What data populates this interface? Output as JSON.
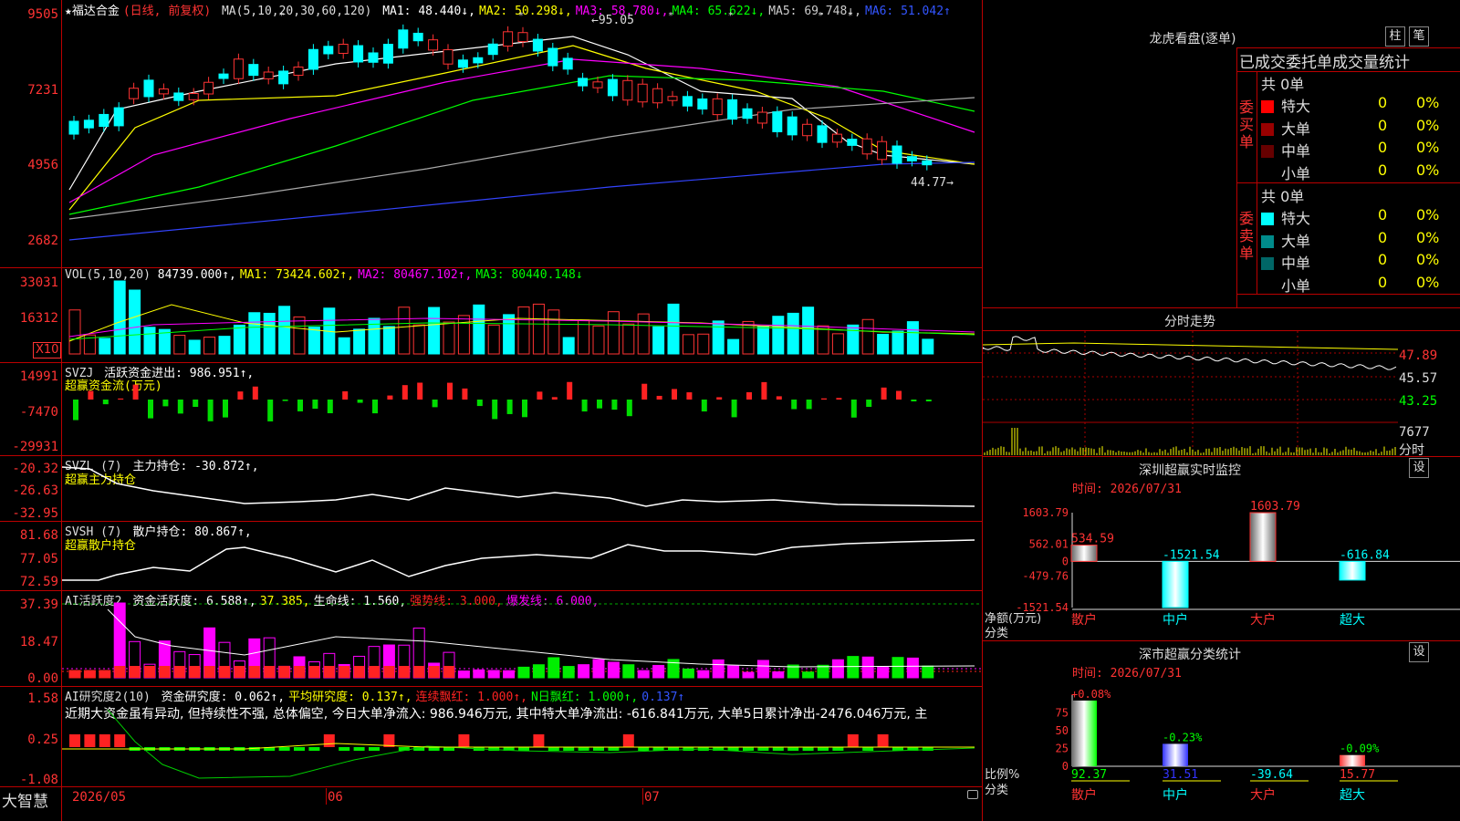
{
  "main_chart": {
    "title_star": "★",
    "stock_name": "福达合金",
    "period": "(日线, 前复权)",
    "ma_label": "MA(5,10,20,30,60,120)",
    "ma": [
      {
        "text": "MA1: 48.440↓,",
        "color": "#ffffff"
      },
      {
        "text": "MA2: 50.298↓,",
        "color": "#ffff00"
      },
      {
        "text": "MA3: 58.780↓,",
        "color": "#ff00ff"
      },
      {
        "text": "MA4: 65.622↓,",
        "color": "#00ff00"
      },
      {
        "text": "MA5: 69.748↓,",
        "color": "#cccccc"
      },
      {
        "text": "MA6: 51.042↑",
        "color": "#3355ff"
      }
    ],
    "y_labels": [
      "9505",
      "7231",
      "4956",
      "2682"
    ],
    "high_label": "95.05",
    "low_label": "44.77"
  },
  "vol_panel": {
    "label": "VOL(5,10,20)",
    "value": "84739.000↑,",
    "ma": [
      {
        "text": "MA1: 73424.602↑,",
        "color": "#ffff00"
      },
      {
        "text": "MA2: 80467.102↑,",
        "color": "#ff00ff"
      },
      {
        "text": "MA3: 80440.148↓",
        "color": "#00ff00"
      }
    ],
    "y_labels": [
      "33031",
      "16312"
    ],
    "unit": "X10"
  },
  "svzj_panel": {
    "label": "SVZJ",
    "value_text": "活跃资金进出: 986.951↑,",
    "subtitle": "超赢资金流(万元)",
    "y_labels": [
      "14991",
      "-7470",
      "-29931"
    ]
  },
  "svzl_panel": {
    "label": "SVZL (7)",
    "value_text": "主力持仓: -30.872↑,",
    "subtitle": "超赢主力持仓",
    "y_labels": [
      "-20.32",
      "-26.63",
      "-32.95"
    ]
  },
  "svsh_panel": {
    "label": "SVSH (7)",
    "value_text": "散户持仓: 80.867↑,",
    "subtitle": "超赢散户持仓",
    "y_labels": [
      "81.68",
      "77.05",
      "72.59"
    ]
  },
  "ai_active_panel": {
    "label": "AI活跃度2",
    "items": [
      {
        "text": "资金活跃度: 6.588↑,",
        "color": "#ffffff"
      },
      {
        "text": "37.385,",
        "color": "#ffff00"
      },
      {
        "text": "生命线: 1.560,",
        "color": "#ffffff"
      },
      {
        "text": "强势线: 3.000,",
        "color": "#ff2222"
      },
      {
        "text": "爆发线: 6.000,",
        "color": "#ff00ff"
      }
    ],
    "y_labels": [
      "37.39",
      "18.47",
      "0.00"
    ]
  },
  "ai_research_panel": {
    "label": "AI研究度2(10)",
    "items": [
      {
        "text": "资金研究度: 0.062↑,",
        "color": "#ffffff"
      },
      {
        "text": "平均研究度: 0.137↑,",
        "color": "#ffff00"
      },
      {
        "text": "连续飘红: 1.000↑,",
        "color": "#ff2222"
      },
      {
        "text": "N日飘红: 1.000↑,",
        "color": "#00ff00"
      },
      {
        "text": "0.137↑",
        "color": "#3355ff"
      }
    ],
    "comment": "近期大资金虽有异动, 但持续性不强, 总体偏空, 今日大单净流入: 986.946万元, 其中特大单净流出: -616.841万元, 大单5日累计净出-2476.046万元, 主",
    "y_labels": [
      "1.58",
      "0.25",
      "-1.08"
    ]
  },
  "bottom_bar": {
    "brand": "大智慧",
    "dates": [
      "2026/05",
      "06",
      "07"
    ]
  },
  "dragon_panel": {
    "title": "龙虎看盘(逐单)",
    "btn_zhu": "柱",
    "btn_bi": "笔",
    "header": "已成交委托单成交量统计",
    "buy": {
      "side_label": "委买单",
      "total": "共 0单",
      "rows": [
        {
          "label": "特大",
          "count": "0",
          "pct": "0%",
          "color": "#ff0000"
        },
        {
          "label": "大单",
          "count": "0",
          "pct": "0%",
          "color": "#990000"
        },
        {
          "label": "中单",
          "count": "0",
          "pct": "0%",
          "color": "#660000"
        },
        {
          "label": "小单",
          "count": "0",
          "pct": "0%",
          "color": ""
        }
      ]
    },
    "sell": {
      "side_label": "委卖单",
      "total": "共 0单",
      "rows": [
        {
          "label": "特大",
          "count": "0",
          "pct": "0%",
          "color": "#00ffff"
        },
        {
          "label": "大单",
          "count": "0",
          "pct": "0%",
          "color": "#008b8b"
        },
        {
          "label": "中单",
          "count": "0",
          "pct": "0%",
          "color": "#006666"
        },
        {
          "label": "小单",
          "count": "0",
          "pct": "0%",
          "color": ""
        }
      ]
    }
  },
  "intraday_panel": {
    "title": "分时走势",
    "y_labels": [
      "47.89",
      "45.57",
      "43.25"
    ],
    "vol_label": "7677",
    "vol_unit": "分时"
  },
  "sz_monitor": {
    "title": "深圳超赢实时监控",
    "btn": "设",
    "time": "时间: 2026/07/31",
    "y_labels": [
      "1603.79",
      "562.01",
      "0",
      "-479.76",
      "-1521.54"
    ],
    "ylabel": "净额(万元)",
    "xlabel": "分类",
    "categories": [
      "散户",
      "中户",
      "大户",
      "超大"
    ],
    "values": [
      534.59,
      -1521.54,
      1603.79,
      -616.84
    ],
    "value_labels": [
      "534.59",
      "-1521.54",
      "1603.79",
      "-616.84"
    ]
  },
  "sz_class": {
    "title": "深市超赢分类统计",
    "btn": "设",
    "time": "时间: 2026/07/31",
    "y_labels": [
      "75",
      "50",
      "25",
      "0"
    ],
    "ylabel": "比例%",
    "xlabel": "分类",
    "categories": [
      "散户",
      "中户",
      "大户",
      "超大"
    ],
    "top_labels": [
      "+0.08%",
      "-0.23%",
      "",
      "-0.09%"
    ],
    "bottom_labels": [
      "92.37",
      "31.51",
      "-39.64",
      "15.77"
    ],
    "values": [
      92.37,
      31.51,
      0,
      15.77
    ]
  }
}
